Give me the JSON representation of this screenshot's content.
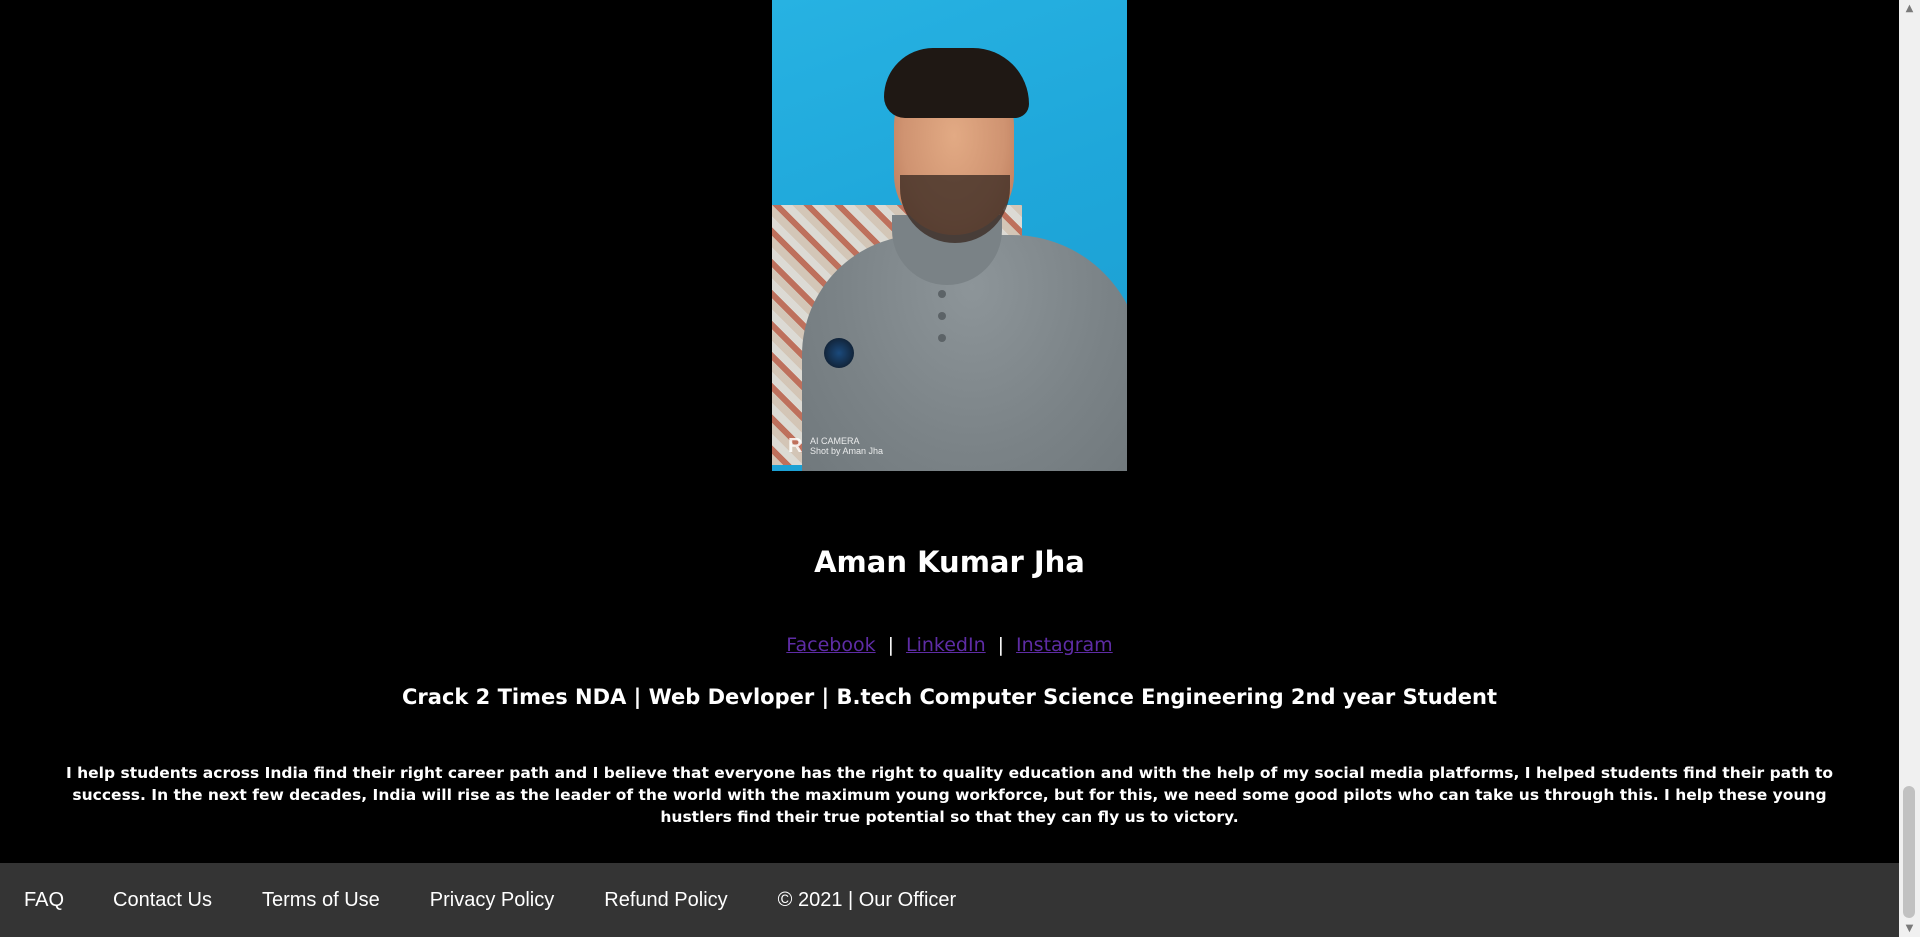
{
  "profile": {
    "name": "Aman Kumar Jha",
    "photo_watermark": {
      "brand_mark": "R",
      "line1": "AI CAMERA",
      "line2": "Shot by Aman Jha"
    },
    "social_links": [
      {
        "label": "Facebook"
      },
      {
        "label": "LinkedIn"
      },
      {
        "label": "Instagram"
      }
    ],
    "separator": "|",
    "tagline": "Crack 2 Times NDA | Web Devloper | B.tech Computer Science Engineering 2nd year Student",
    "bio": "I help students across India find their right career path and I believe that everyone has the right to quality education and with the help of my social media platforms, I helped students find their path to success. In the next few decades, India will rise as the leader of the world with the maximum young workforce, but for this, we need some good pilots who can take us through this. I help these young hustlers find their true potential so that they can fly us to victory."
  },
  "footer": {
    "links": [
      {
        "label": "FAQ"
      },
      {
        "label": "Contact Us"
      },
      {
        "label": "Terms of Use"
      },
      {
        "label": "Privacy Policy"
      },
      {
        "label": "Refund Policy"
      }
    ],
    "copyright": "© 2021 | Our Officer"
  },
  "scrollbar": {
    "up_icon": "▲",
    "down_icon": "▼"
  },
  "colors": {
    "page_background": "#000000",
    "footer_background": "#343434",
    "link_color": "#5e2ca5",
    "text_color": "#ffffff"
  }
}
